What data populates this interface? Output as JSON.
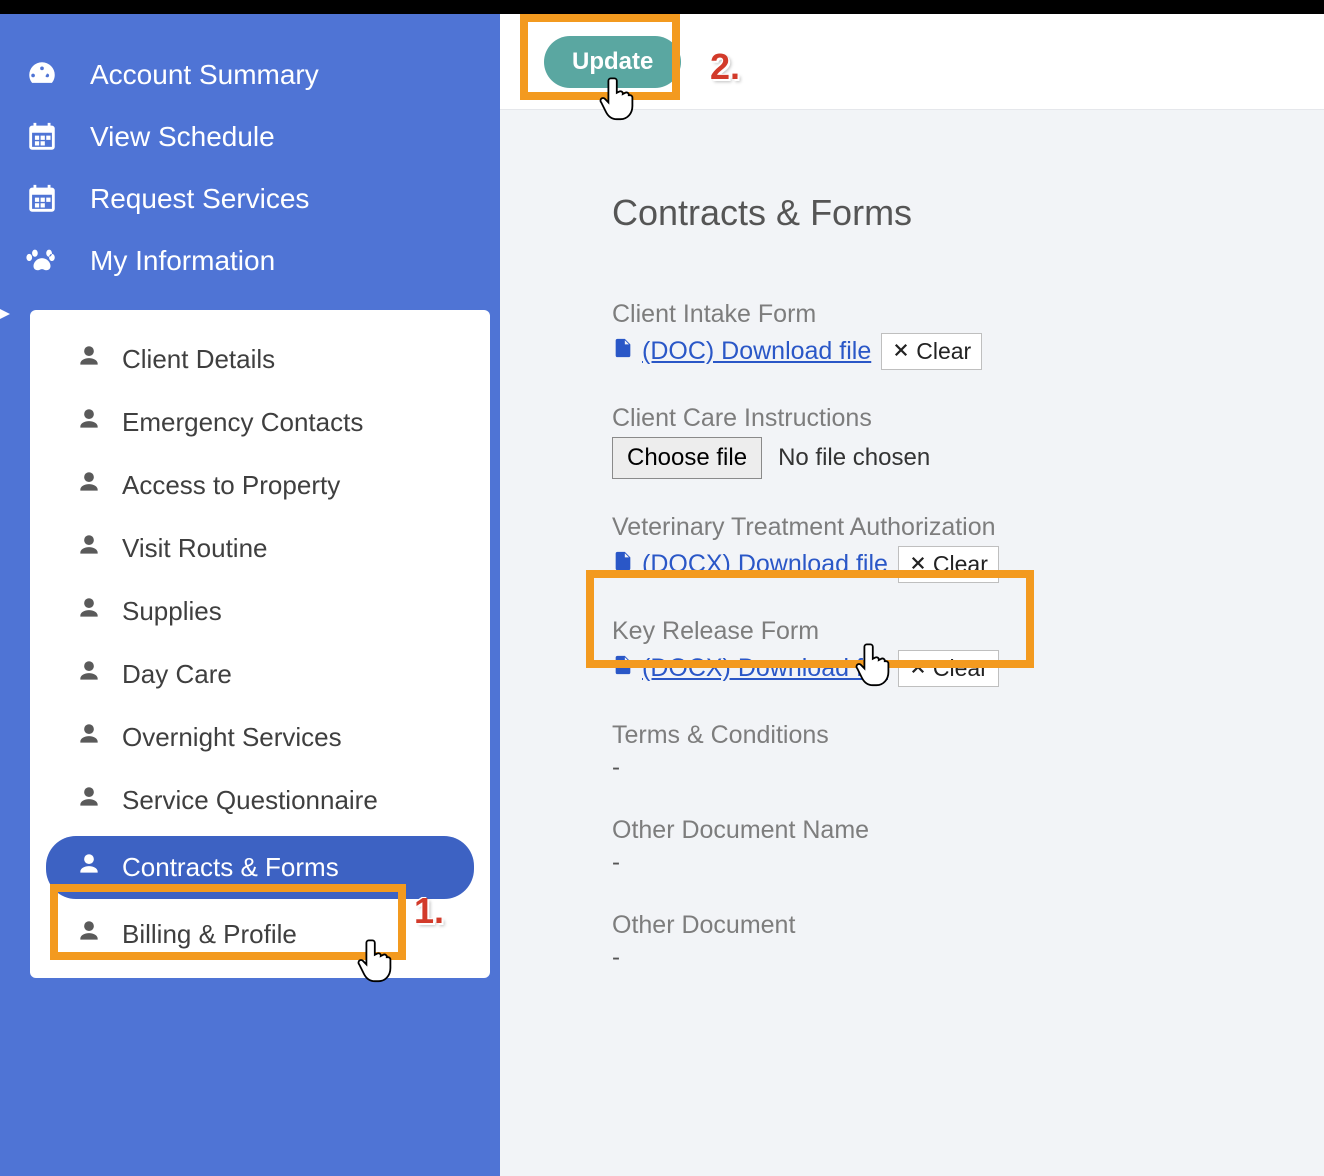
{
  "sidebar": {
    "nav": [
      {
        "label": "Account Summary"
      },
      {
        "label": "View Schedule"
      },
      {
        "label": "Request Services"
      },
      {
        "label": "My Information"
      }
    ],
    "sub": [
      {
        "label": "Client Details"
      },
      {
        "label": "Emergency Contacts"
      },
      {
        "label": "Access to Property"
      },
      {
        "label": "Visit Routine"
      },
      {
        "label": "Supplies"
      },
      {
        "label": "Day Care"
      },
      {
        "label": "Overnight Services"
      },
      {
        "label": "Service Questionnaire"
      },
      {
        "label": "Contracts & Forms"
      },
      {
        "label": "Billing & Profile"
      }
    ]
  },
  "header": {
    "update": "Update"
  },
  "page": {
    "title": "Contracts & Forms"
  },
  "buttons": {
    "clear": "Clear",
    "choose_file": "Choose file",
    "no_file": "No file chosen"
  },
  "forms": {
    "client_intake": {
      "label": "Client Intake Form",
      "link": "(DOC) Download file"
    },
    "care_instr": {
      "label": "Client Care Instructions"
    },
    "vet_auth": {
      "label": "Veterinary Treatment Authorization",
      "link": "(DOCX) Download file"
    },
    "key_release": {
      "label": "Key Release Form",
      "link": "(DOCX) Download file"
    },
    "terms": {
      "label": "Terms & Conditions",
      "value": "-"
    },
    "other_name": {
      "label": "Other Document Name",
      "value": "-"
    },
    "other_doc": {
      "label": "Other Document",
      "value": "-"
    }
  },
  "annotations": {
    "step1": "1.",
    "step2": "2."
  }
}
